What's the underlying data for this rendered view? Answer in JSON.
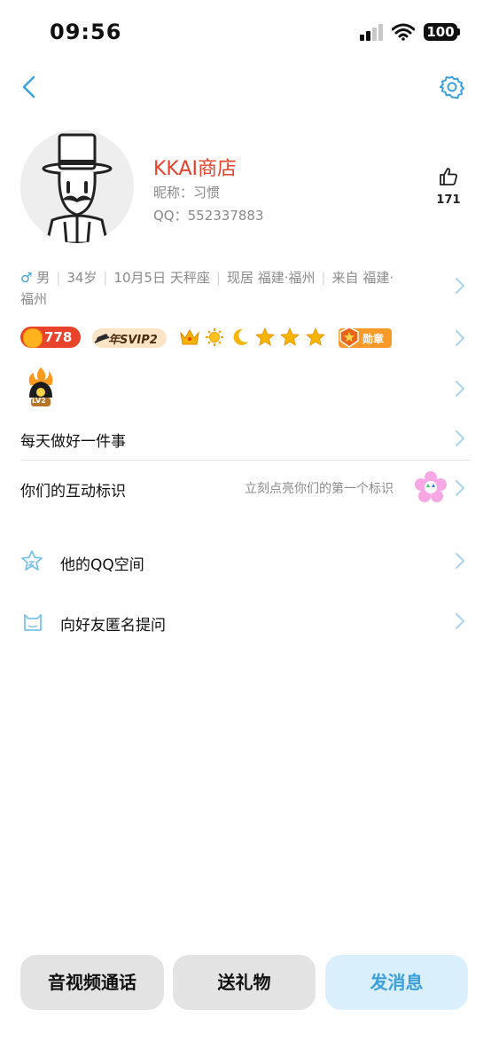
{
  "status_bar": {
    "time": "09:56",
    "battery": "100"
  },
  "profile": {
    "name": "KKAI商店",
    "nickname": "昵称：习惯",
    "qq": "QQ：552337883",
    "likes": "171"
  },
  "info": {
    "gender": "男",
    "age": "34岁",
    "birthday": "10月5日 天秤座",
    "residence": "现居 福建·福州",
    "origin_line1": "来自 福建·",
    "origin_line2": "福州"
  },
  "badges": {
    "coin_value": "778",
    "svip_label": "年SVIP2",
    "medal_label": "勋章",
    "level_label": "LV2"
  },
  "rows": {
    "signature": "每天做好一件事",
    "interaction_label": "你们的互动标识",
    "interaction_hint": "立刻点亮你们的第一个标识",
    "qzone": "他的QQ空间",
    "anonymous": "向好友匿名提问"
  },
  "actions": {
    "call": "音视频通话",
    "gift": "送礼物",
    "message": "发消息"
  },
  "colors": {
    "accent": "#3b9fdc",
    "name": "#e5412b",
    "chevron": "#a9d3ef"
  }
}
